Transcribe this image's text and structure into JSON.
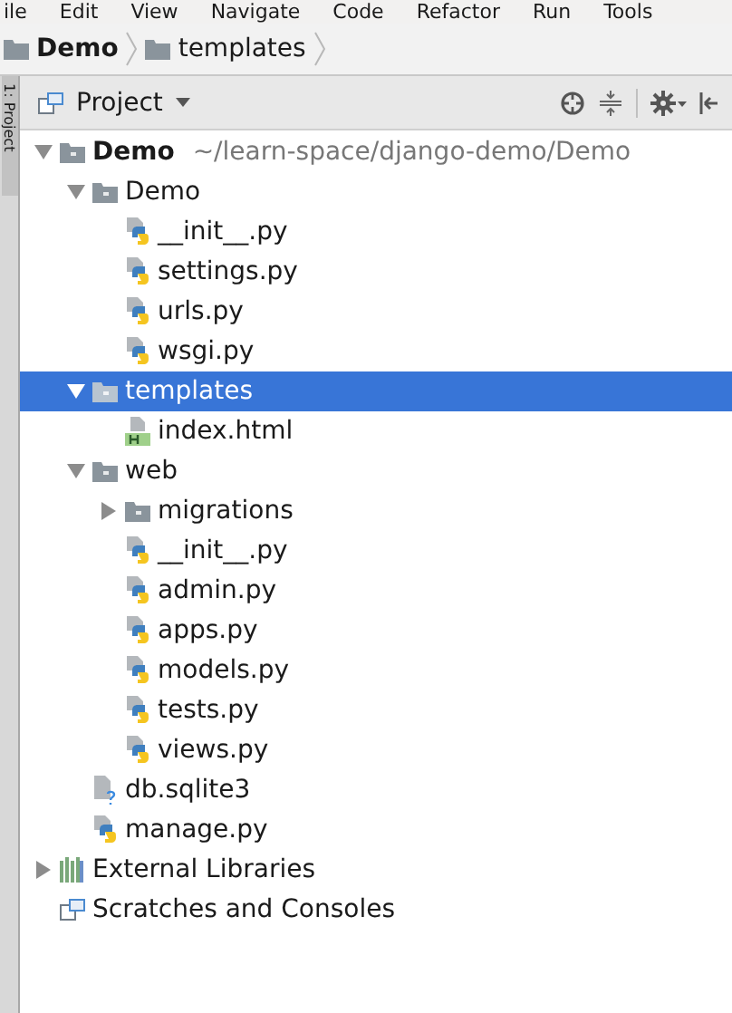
{
  "menu_bar": [
    "ile",
    "Edit",
    "View",
    "Navigate",
    "Code",
    "Refactor",
    "Run",
    "Tools"
  ],
  "breadcrumbs": [
    "Demo",
    "templates"
  ],
  "side_strip": {
    "label": "1: Project"
  },
  "panel": {
    "title": "Project"
  },
  "tree": [
    {
      "label": "Demo",
      "path": "~/learn-space/django-demo/Demo",
      "kind": "folder",
      "expanded": true,
      "selected": false,
      "children": [
        {
          "label": "Demo",
          "kind": "folder",
          "expanded": true,
          "selected": false,
          "children": [
            {
              "label": "__init__.py",
              "kind": "python",
              "selected": false
            },
            {
              "label": "settings.py",
              "kind": "python",
              "selected": false
            },
            {
              "label": "urls.py",
              "kind": "python",
              "selected": false
            },
            {
              "label": "wsgi.py",
              "kind": "python",
              "selected": false
            }
          ]
        },
        {
          "label": "templates",
          "kind": "folder",
          "expanded": true,
          "selected": true,
          "children": [
            {
              "label": "index.html",
              "kind": "html",
              "selected": false
            }
          ]
        },
        {
          "label": "web",
          "kind": "folder",
          "expanded": true,
          "selected": false,
          "children": [
            {
              "label": "migrations",
              "kind": "folder",
              "expanded": false,
              "selected": false
            },
            {
              "label": "__init__.py",
              "kind": "python",
              "selected": false
            },
            {
              "label": "admin.py",
              "kind": "python",
              "selected": false
            },
            {
              "label": "apps.py",
              "kind": "python",
              "selected": false
            },
            {
              "label": "models.py",
              "kind": "python",
              "selected": false
            },
            {
              "label": "tests.py",
              "kind": "python",
              "selected": false
            },
            {
              "label": "views.py",
              "kind": "python",
              "selected": false
            }
          ]
        },
        {
          "label": "db.sqlite3",
          "kind": "unknown",
          "selected": false
        },
        {
          "label": "manage.py",
          "kind": "python",
          "selected": false
        }
      ]
    },
    {
      "label": "External Libraries",
      "kind": "libraries",
      "expanded": false,
      "selected": false
    },
    {
      "label": "Scratches and Consoles",
      "kind": "scratches",
      "selected": false
    }
  ]
}
